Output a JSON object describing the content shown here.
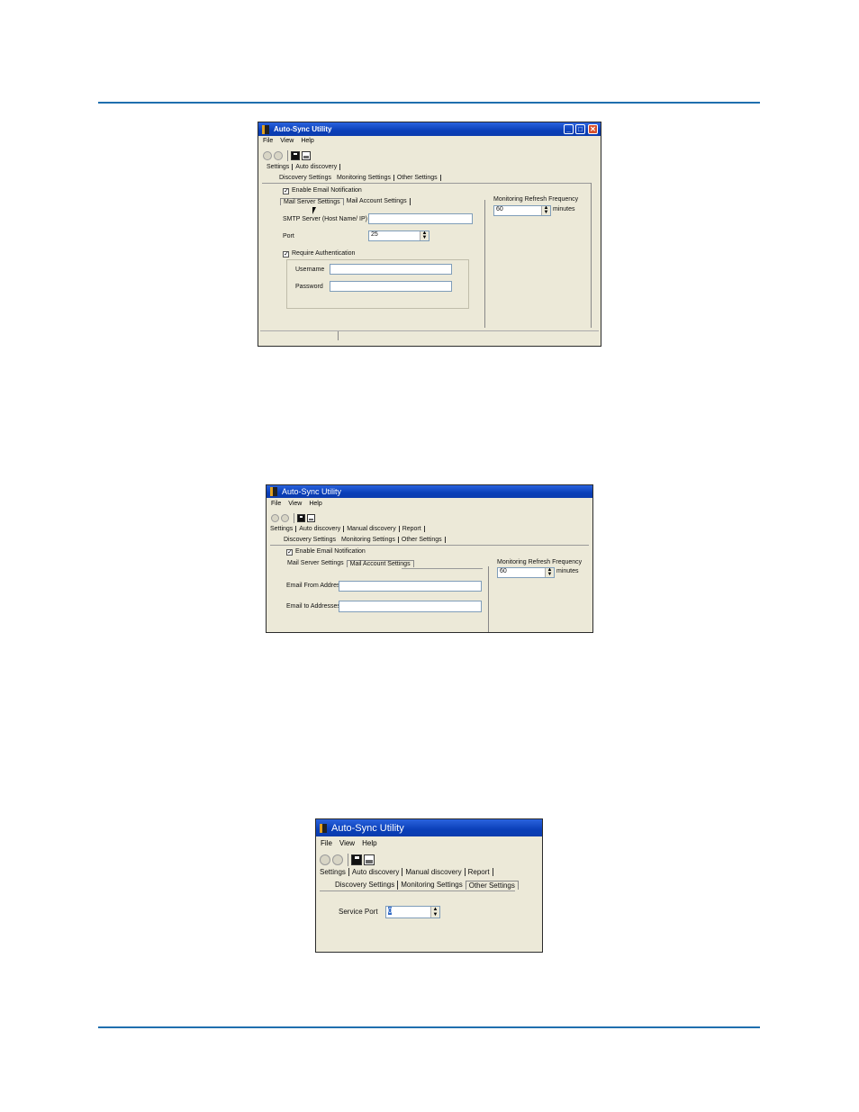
{
  "screenshots": [
    {
      "window_title": "Auto-Sync Utility",
      "menu": [
        "File",
        "View",
        "Help"
      ],
      "main_tabs": [
        "Settings",
        "Auto discovery"
      ],
      "sub_tabs": [
        "Discovery Settings",
        "Monitoring Settings",
        "Other Settings"
      ],
      "enable_email_label": "Enable Email Notification",
      "mail_tabs": [
        "Mail Server Settings",
        "Mail Account Settings"
      ],
      "smtp_label": "SMTP Server (Host Name/ IP)",
      "smtp_value": "",
      "port_label": "Port",
      "port_value": "25",
      "require_auth_label": "Require Authentication",
      "username_label": "Username",
      "password_label": "Password",
      "refresh_label": "Monitoring Refresh Frequency",
      "refresh_value": "60",
      "refresh_unit": "minutes"
    },
    {
      "window_title": "Auto-Sync Utility",
      "menu": [
        "File",
        "View",
        "Help"
      ],
      "main_tabs": [
        "Settings",
        "Auto discovery",
        "Manual discovery",
        "Report"
      ],
      "sub_tabs": [
        "Discovery Settings",
        "Monitoring Settings",
        "Other Settings"
      ],
      "enable_email_label": "Enable Email Notification",
      "mail_tabs": [
        "Mail Server Settings",
        "Mail Account Settings"
      ],
      "from_label": "Email From Address",
      "to_label": "Email to Addresses",
      "refresh_label": "Monitoring Refresh Frequency",
      "refresh_value": "60",
      "refresh_unit": "minutes"
    },
    {
      "window_title": "Auto-Sync Utility",
      "menu": [
        "File",
        "View",
        "Help"
      ],
      "main_tabs": [
        "Settings",
        "Auto discovery",
        "Manual discovery",
        "Report"
      ],
      "sub_tabs": [
        "Discovery Settings",
        "Monitoring Settings",
        "Other Settings"
      ],
      "service_port_label": "Service Port",
      "service_port_value": "0"
    }
  ]
}
